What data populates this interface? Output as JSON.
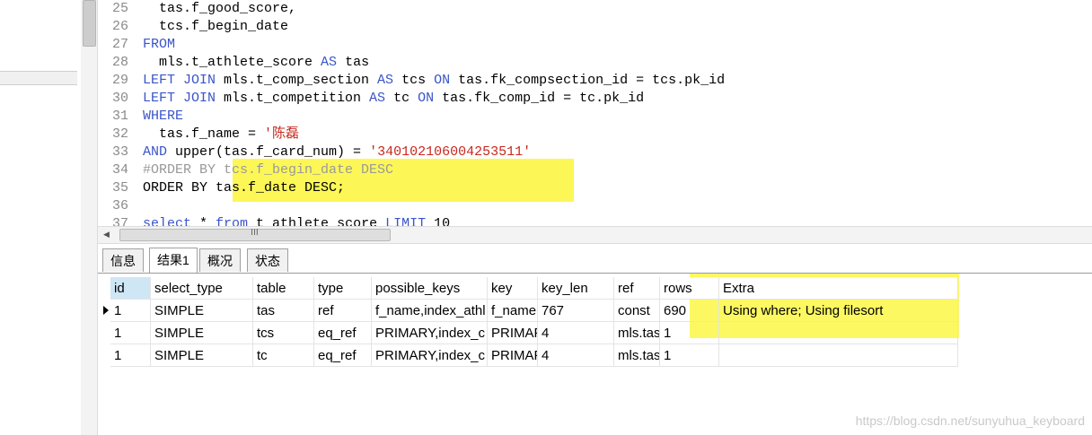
{
  "editor": {
    "lines": [
      {
        "num": "25",
        "html": "  tas.f_good_score,"
      },
      {
        "num": "26",
        "html": "  tcs.f_begin_date"
      },
      {
        "num": "27",
        "html": "<span class=\"kw\">FROM</span>"
      },
      {
        "num": "28",
        "html": "  mls.t_athlete_score <span class=\"kw\">AS</span> tas"
      },
      {
        "num": "29",
        "html": "<span class=\"kw\">LEFT JOIN</span> mls.t_comp_section <span class=\"kw\">AS</span> tcs <span class=\"kw\">ON</span> tas.fk_compsection_id = tcs.pk_id"
      },
      {
        "num": "30",
        "html": "<span class=\"kw\">LEFT JOIN</span> mls.t_competition <span class=\"kw\">AS</span> tc <span class=\"kw\">ON</span> tas.fk_comp_id = tc.pk_id"
      },
      {
        "num": "31",
        "html": "<span class=\"kw\">WHERE</span>"
      },
      {
        "num": "32",
        "html": "  tas.f_name = <span class=\"str\">'陈磊</span>"
      },
      {
        "num": "33",
        "html": "<span class=\"kw\">AND</span> upper(tas.f_card_num) = <span class=\"str\">'340102106004253511'</span>"
      },
      {
        "num": "34",
        "html": "<span class=\"cm\">#ORDER BY tcs.f_begin_date DESC</span>"
      },
      {
        "num": "35",
        "html": "ORDER BY tas.f_date DESC;"
      },
      {
        "num": "36",
        "html": ""
      },
      {
        "num": "37",
        "html": "<span class=\"kw\">select</span> * <span class=\"kw\">from</span> t_athlete_score <span class=\"kw\">LIMIT</span> 10"
      }
    ]
  },
  "scrollbar": {
    "grip": "III",
    "left_arrow": "◀"
  },
  "tabs": [
    {
      "label": "信息",
      "active": false
    },
    {
      "label": "结果1",
      "active": true
    },
    {
      "label": "概况",
      "active": false
    },
    {
      "label": "状态",
      "active": false
    }
  ],
  "result": {
    "columns": [
      "id",
      "select_type",
      "table",
      "type",
      "possible_keys",
      "key",
      "key_len",
      "ref",
      "rows",
      "Extra"
    ],
    "rows": [
      [
        "1",
        "SIMPLE",
        "tas",
        "ref",
        "f_name,index_athl",
        "f_name",
        "767",
        "const",
        "690",
        "Using where; Using filesort"
      ],
      [
        "1",
        "SIMPLE",
        "tcs",
        "eq_ref",
        "PRIMARY,index_c",
        "PRIMAF",
        "4",
        "mls.tas",
        "1",
        ""
      ],
      [
        "1",
        "SIMPLE",
        "tc",
        "eq_ref",
        "PRIMARY,index_c",
        "PRIMAF",
        "4",
        "mls.tas",
        "1",
        ""
      ]
    ]
  },
  "watermark": "https://blog.csdn.net/sunyuhua_keyboard",
  "colors": {
    "highlight": "#fbf63a",
    "keyword": "#3a55c8",
    "string": "#c8281e",
    "comment": "#999999"
  }
}
